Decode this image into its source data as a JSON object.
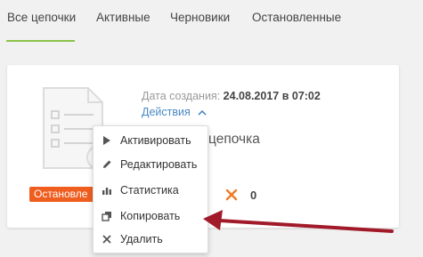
{
  "tabs": [
    {
      "label": "Все цепочки",
      "active": true
    },
    {
      "label": "Активные",
      "active": false
    },
    {
      "label": "Черновики",
      "active": false
    },
    {
      "label": "Остановленные",
      "active": false
    }
  ],
  "card": {
    "date_label": "Дата создания:",
    "date_value": "24.08.2017 в 07:02",
    "actions_label": "Действия",
    "name": "цепочка",
    "status": "Остановле",
    "count": "0"
  },
  "menu": {
    "items": [
      {
        "label": "Активировать",
        "icon": "play-icon"
      },
      {
        "label": "Редактировать",
        "icon": "pencil-icon"
      },
      {
        "label": "Статистика",
        "icon": "bar-chart-icon"
      },
      {
        "label": "Копировать",
        "icon": "copy-icon"
      },
      {
        "label": "Удалить",
        "icon": "close-icon"
      }
    ]
  },
  "colors": {
    "accent": "#8bc34a",
    "link": "#4a8ac4",
    "status": "#ef5d1f",
    "error": "#f07a25",
    "annotation_arrow": "#a11a2a"
  }
}
